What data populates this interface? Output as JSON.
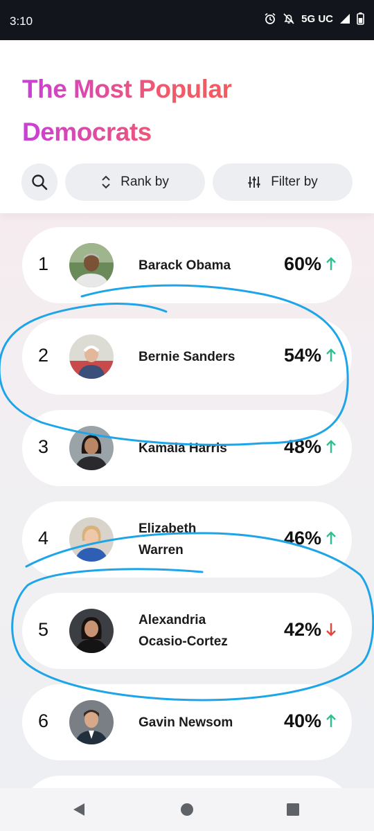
{
  "status_bar": {
    "time": "3:10",
    "network": "5G UC",
    "icons": [
      "alarm-icon",
      "mute-icon",
      "signal-icon",
      "battery-icon"
    ]
  },
  "header": {
    "title_line1": "The Most Popular",
    "title_line2": "Democrats",
    "title_gradient": [
      "#c93fd8",
      "#f05a6b",
      "#ff5a4a"
    ]
  },
  "toolbar": {
    "search_icon": "search-icon",
    "rank_label": "Rank by",
    "filter_label": "Filter by"
  },
  "colors": {
    "trend_up": "#2dbf8f",
    "trend_down": "#e5443a",
    "annotation": "#1ea5e8"
  },
  "rankings": [
    {
      "rank": "1",
      "name_lines": [
        "Barack Obama"
      ],
      "percent": "60%",
      "trend": "up"
    },
    {
      "rank": "2",
      "name_lines": [
        "Bernie Sanders"
      ],
      "percent": "54%",
      "trend": "up"
    },
    {
      "rank": "3",
      "name_lines": [
        "Kamala Harris"
      ],
      "percent": "48%",
      "trend": "up"
    },
    {
      "rank": "4",
      "name_lines": [
        "Elizabeth",
        "Warren"
      ],
      "percent": "46%",
      "trend": "up"
    },
    {
      "rank": "5",
      "name_lines": [
        "Alexandria",
        "Ocasio-Cortez"
      ],
      "percent": "42%",
      "trend": "down"
    },
    {
      "rank": "6",
      "name_lines": [
        "Gavin Newsom"
      ],
      "percent": "40%",
      "trend": "up"
    }
  ],
  "nav_bar": {
    "buttons": [
      "back-icon",
      "home-icon",
      "recents-icon"
    ]
  }
}
